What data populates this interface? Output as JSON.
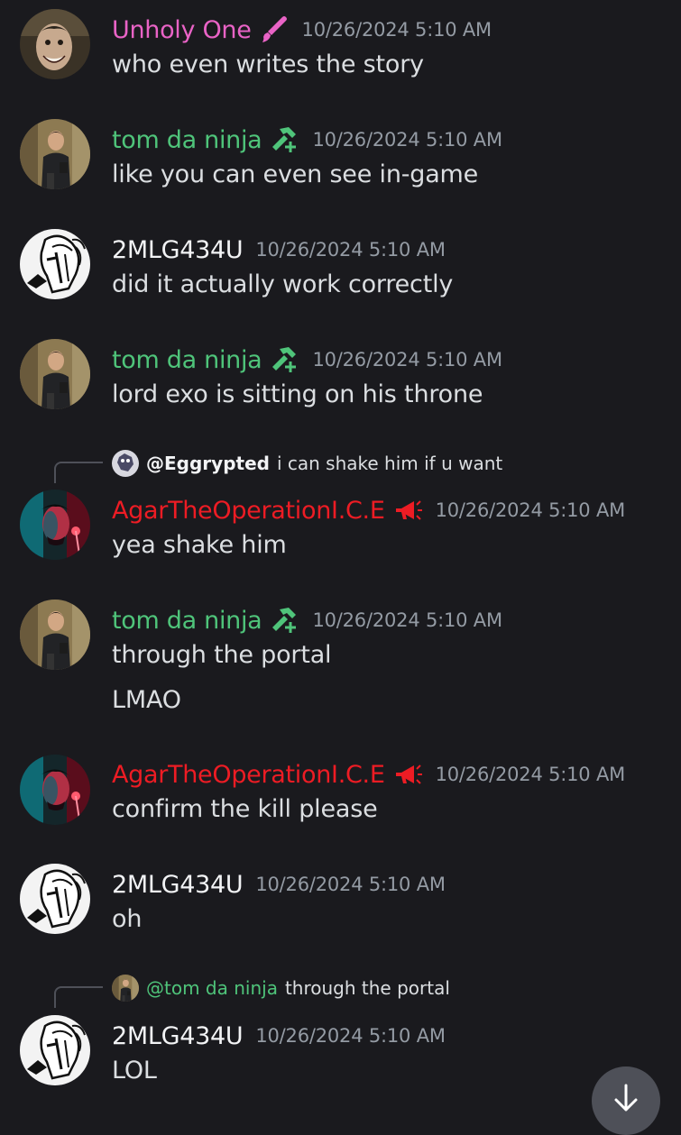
{
  "colors": {
    "background": "#1a1a1e",
    "unholy_pink": "#e963c6",
    "ninja_green": "#4fc47a",
    "agar_red": "#ed1c24",
    "default_name": "#f2f3f5",
    "timestamp_gray": "#949ba4",
    "text": "#dbdee1"
  },
  "messages": [
    {
      "author": "Unholy One",
      "badge_icon": "paintbrush-icon",
      "timestamp": "10/26/2024 5:10 AM",
      "lines": [
        "who even writes the story"
      ]
    },
    {
      "author": "tom da ninja",
      "badge_icon": "hammer-icon",
      "timestamp": "10/26/2024 5:10 AM",
      "lines": [
        "like you can even see in-game"
      ]
    },
    {
      "author": "2MLG434U",
      "timestamp": "10/26/2024 5:10 AM",
      "lines": [
        "did it actually work correctly"
      ]
    },
    {
      "author": "tom da ninja",
      "badge_icon": "hammer-icon",
      "timestamp": "10/26/2024 5:10 AM",
      "lines": [
        "lord exo is sitting on his throne"
      ]
    },
    {
      "reply_to": {
        "user": "@Eggrypted",
        "text": "i can shake him if u want"
      },
      "author": "AgarTheOperationI.C.E",
      "badge_icon": "megaphone-icon",
      "timestamp": "10/26/2024 5:10 AM",
      "lines": [
        "yea shake him"
      ]
    },
    {
      "author": "tom da ninja",
      "badge_icon": "hammer-icon",
      "timestamp": "10/26/2024 5:10 AM",
      "lines": [
        "through the portal",
        "LMAO"
      ]
    },
    {
      "author": "AgarTheOperationI.C.E",
      "badge_icon": "megaphone-icon",
      "timestamp": "10/26/2024 5:10 AM",
      "lines": [
        "confirm the kill please"
      ]
    },
    {
      "author": "2MLG434U",
      "timestamp": "10/26/2024 5:10 AM",
      "lines": [
        "oh"
      ]
    },
    {
      "reply_to": {
        "user": "@tom da ninja",
        "text": "through the portal"
      },
      "author": "2MLG434U",
      "timestamp": "10/26/2024 5:10 AM",
      "lines": [
        "LOL"
      ]
    }
  ],
  "scroll_button": {
    "icon": "arrow-down-icon"
  }
}
